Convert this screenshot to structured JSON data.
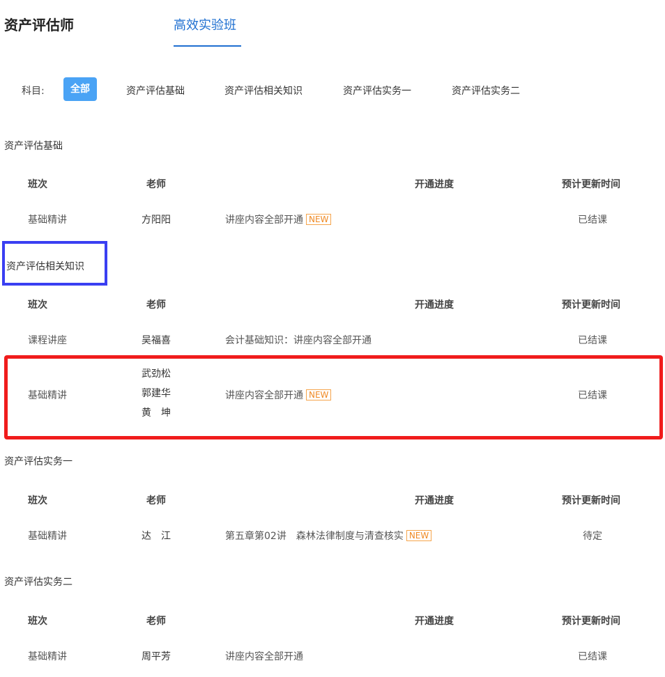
{
  "header": {
    "title": "资产评估师",
    "tab": "高效实验班"
  },
  "subjects": {
    "label": "科目:",
    "options": [
      "全部",
      "资产评估基础",
      "资产评估相关知识",
      "资产评估实务一",
      "资产评估实务二"
    ]
  },
  "columns": [
    "班次",
    "老师",
    "开通进度",
    "预计更新时间"
  ],
  "new_badge": "NEW",
  "sections": [
    {
      "title": "资产评估基础",
      "rows": [
        {
          "class": "基础精讲",
          "teachers": [
            "方阳阳"
          ],
          "progress": "讲座内容全部开通",
          "new": true,
          "update": "已结课"
        }
      ]
    },
    {
      "title": "资产评估相关知识",
      "rows": [
        {
          "class": "课程讲座",
          "teachers": [
            "吴福喜"
          ],
          "progress": "会计基础知识：讲座内容全部开通",
          "new": false,
          "update": "已结课"
        },
        {
          "class": "基础精讲",
          "teachers": [
            "武劲松",
            "郭建华",
            "黄　坤"
          ],
          "progress": "讲座内容全部开通",
          "new": true,
          "update": "已结课"
        }
      ]
    },
    {
      "title": "资产评估实务一",
      "rows": [
        {
          "class": "基础精讲",
          "teachers": [
            "达　江"
          ],
          "progress": "第五章第02讲　森林法律制度与清查核实",
          "new": true,
          "update": "待定"
        }
      ]
    },
    {
      "title": "资产评估实务二",
      "rows": [
        {
          "class": "基础精讲",
          "teachers": [
            "周平芳"
          ],
          "progress": "讲座内容全部开通",
          "new": false,
          "update": "已结课"
        }
      ]
    }
  ]
}
